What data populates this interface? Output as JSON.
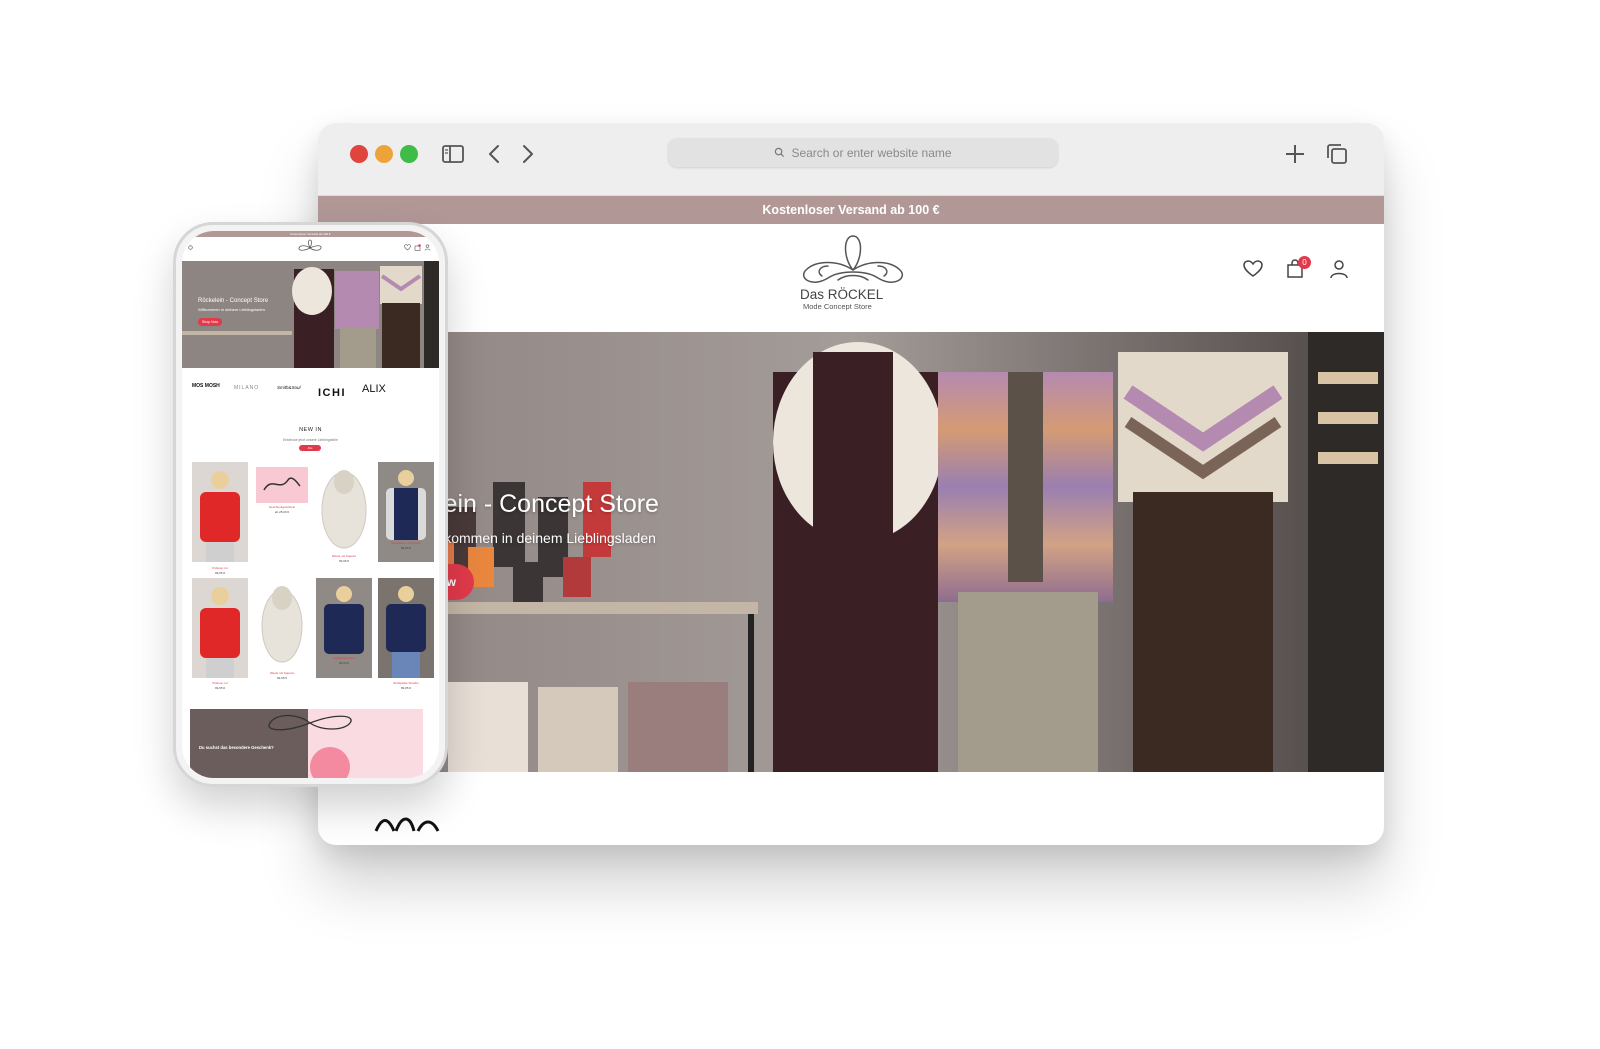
{
  "browser": {
    "address_placeholder": "Search or enter website name",
    "promo": "Kostenloser Versand ab 100 €",
    "logo_line1": "Das RÖCKEL",
    "logo_line2": "Mode Concept Store",
    "cart_count": "0",
    "hero_title": "lein - Concept Store",
    "hero_subtitle": "llkommen in deinem Lieblingsladen",
    "hero_button": "ow"
  },
  "phone": {
    "promo": "Kostenloser Versand ab 100 €",
    "hero_title": "Röckelein - Concept Store",
    "hero_subtitle": "Willkommen in deinem Lieblingsladen",
    "hero_button": "Shop Now",
    "brands": [
      "MOS MOSH",
      "MILANO",
      "Smith&Soul",
      "ICHI",
      "ALIX"
    ],
    "new_in_title": "NEW IN",
    "new_in_subtitle": "Entdecke jetzt unsere Lieblingsteile",
    "new_in_button": "Alle",
    "products": [
      {
        "label": "Pullover rot",
        "price": "99,95 €"
      },
      {
        "label": "Geschenkgutschein",
        "price": "ab 25,00 €"
      },
      {
        "label": "Weste mit Kapuze",
        "price": "99,95 €"
      },
      {
        "label": "Strickjacke mit Streifen",
        "price": "89,95 €"
      },
      {
        "label": "Pullover rot",
        "price": "99,95 €"
      },
      {
        "label": "Weste mit Kapuze",
        "price": "99,95 €"
      },
      {
        "label": "Strickjacke Navy",
        "price": "89,95 €"
      },
      {
        "label": "Strickjacke Streifen",
        "price": "89,95 €"
      }
    ],
    "banner_text": "Du suchst das besondere Geschenk?"
  },
  "colors": {
    "promo_bar": "#b29797",
    "accent": "#e23a4b"
  }
}
